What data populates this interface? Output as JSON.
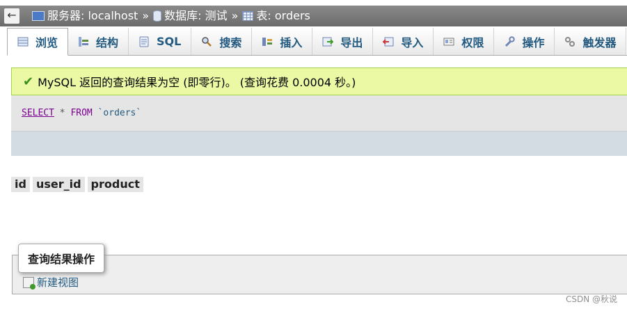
{
  "breadcrumb": {
    "back": "←",
    "server": "服务器: localhost",
    "database": "数据库: 测试",
    "table": "表: orders",
    "separator": "»"
  },
  "tabs": [
    {
      "label": "浏览",
      "icon": "browse-icon",
      "active": true
    },
    {
      "label": "结构",
      "icon": "structure-icon"
    },
    {
      "label": "SQL",
      "icon": "sql-icon"
    },
    {
      "label": "搜索",
      "icon": "search-icon"
    },
    {
      "label": "插入",
      "icon": "insert-icon"
    },
    {
      "label": "导出",
      "icon": "export-icon"
    },
    {
      "label": "导入",
      "icon": "import-icon"
    },
    {
      "label": "权限",
      "icon": "privileges-icon"
    },
    {
      "label": "操作",
      "icon": "wrench-icon"
    },
    {
      "label": "触发器",
      "icon": "triggers-icon"
    }
  ],
  "notice": {
    "text": "MySQL 返回的查询结果为空 (即零行)。 (查询花费 0.0004 秒。)",
    "color": "#ebf8a4"
  },
  "sql": {
    "select": "SELECT",
    "star": "*",
    "from": "FROM",
    "table": "`orders`"
  },
  "columns": [
    "id",
    "user_id",
    "product"
  ],
  "operations": {
    "legend": "查询结果操作",
    "create_view": "新建视图"
  },
  "watermark": "CSDN @秋说",
  "colors": {
    "link": "#235a81",
    "crumb_bg": "#7a7a7a",
    "toolbar": "#d3dce3"
  }
}
